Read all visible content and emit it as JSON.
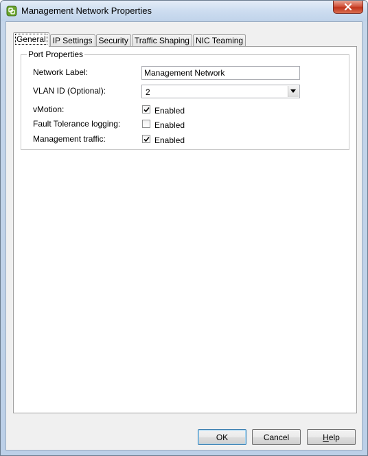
{
  "window": {
    "title": "Management Network Properties"
  },
  "tabs": [
    {
      "label": "General",
      "active": true
    },
    {
      "label": "IP Settings",
      "active": false
    },
    {
      "label": "Security",
      "active": false
    },
    {
      "label": "Traffic Shaping",
      "active": false
    },
    {
      "label": "NIC Teaming",
      "active": false
    }
  ],
  "port_properties": {
    "group_title": "Port Properties",
    "network_label": {
      "label": "Network Label:",
      "value": "Management Network"
    },
    "vlan_id": {
      "label": "VLAN ID (Optional):",
      "value": "2"
    },
    "vmotion": {
      "label": "vMotion:",
      "checkbox_label": "Enabled",
      "checked": true
    },
    "fault_tolerance": {
      "label": "Fault Tolerance logging:",
      "checkbox_label": "Enabled",
      "checked": false
    },
    "management_traffic": {
      "label": "Management traffic:",
      "checkbox_label": "Enabled",
      "checked": true
    }
  },
  "buttons": {
    "ok": "OK",
    "cancel": "Cancel",
    "help_first": "H",
    "help_rest": "elp"
  },
  "icons": {
    "app": "vsphere-app-icon",
    "close": "close-icon",
    "dropdown": "chevron-down-icon",
    "check": "check-icon"
  },
  "colors": {
    "titlebar": "#cdddf0",
    "close_button": "#c0341b",
    "dialog_background": "#f0f0f0"
  }
}
